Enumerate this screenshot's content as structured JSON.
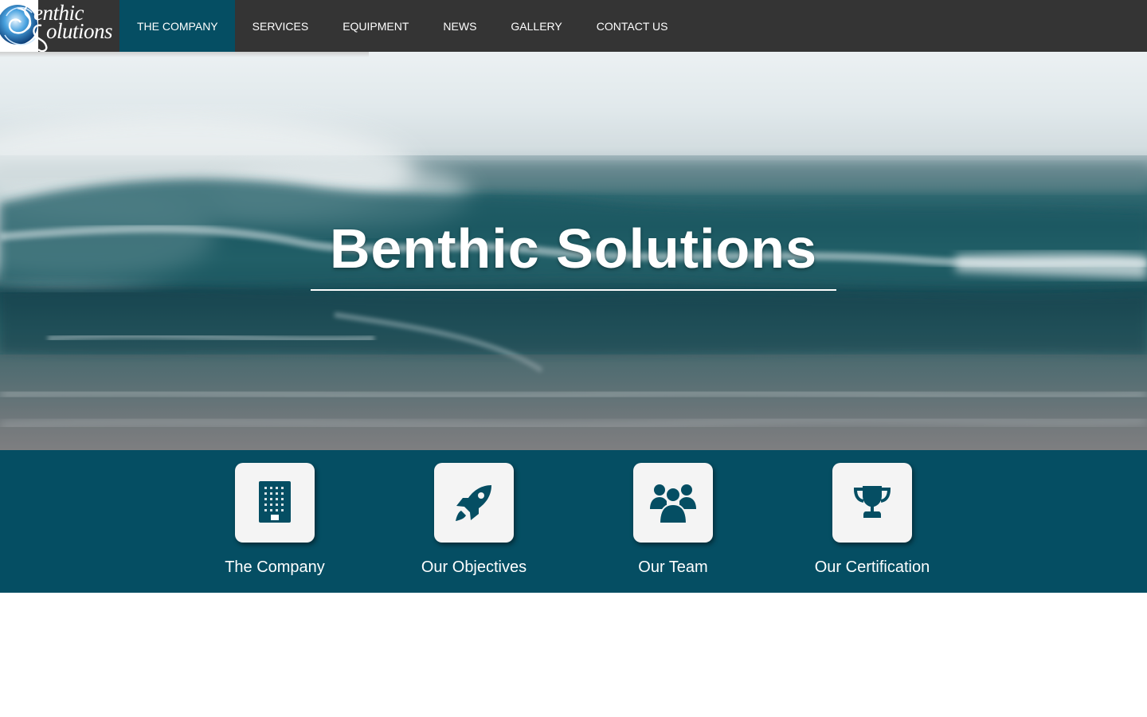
{
  "brand": {
    "logo_line1": "enthic",
    "logo_line2": "olutions",
    "accent_color": "#054e63",
    "nav_bg": "#343434"
  },
  "nav": {
    "items": [
      {
        "label": "THE COMPANY",
        "active": true
      },
      {
        "label": "SERVICES",
        "active": false
      },
      {
        "label": "EQUIPMENT",
        "active": false
      },
      {
        "label": "NEWS",
        "active": false
      },
      {
        "label": "GALLERY",
        "active": false
      },
      {
        "label": "CONTACT US",
        "active": false
      }
    ]
  },
  "hero": {
    "title": "Benthic Solutions"
  },
  "features": [
    {
      "label": "The Company",
      "icon": "building-icon"
    },
    {
      "label": "Our Objectives",
      "icon": "rocket-icon"
    },
    {
      "label": "Our Team",
      "icon": "users-icon"
    },
    {
      "label": "Our Certification",
      "icon": "trophy-icon"
    }
  ]
}
